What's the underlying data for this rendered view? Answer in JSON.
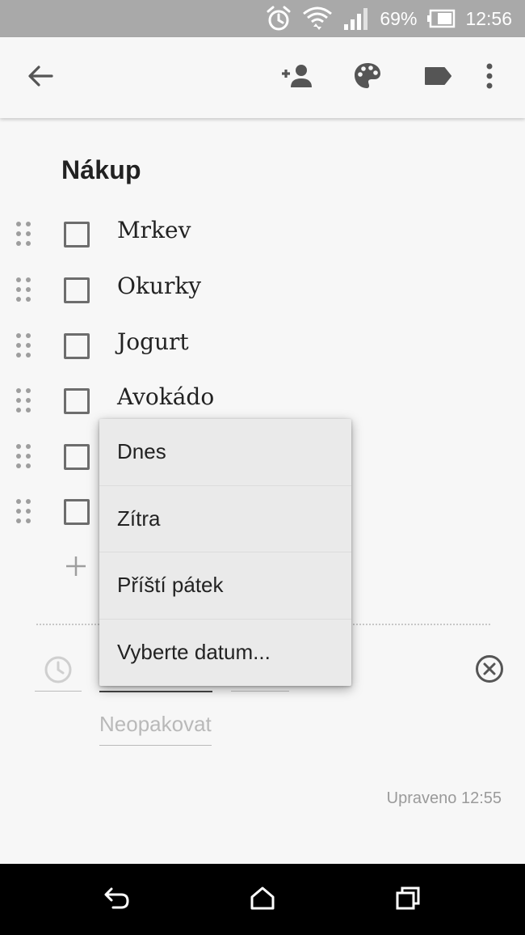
{
  "status_bar": {
    "battery_percent": "69%",
    "time": "12:56",
    "icons": [
      "alarm-icon",
      "wifi-icon",
      "signal-icon",
      "battery-icon"
    ]
  },
  "toolbar": {
    "icons": [
      "back-arrow-icon",
      "add-collaborator-icon",
      "palette-icon",
      "label-icon",
      "more-options-icon"
    ]
  },
  "note": {
    "title": "Nákup",
    "items": [
      {
        "label": "Mrkev",
        "checked": false
      },
      {
        "label": "Okurky",
        "checked": false
      },
      {
        "label": "Jogurt",
        "checked": false
      },
      {
        "label": "Avokádo",
        "checked": false
      },
      {
        "label": "",
        "checked": false
      },
      {
        "label": "",
        "checked": false
      }
    ]
  },
  "reminder": {
    "repeat_placeholder": "Neopakovat"
  },
  "date_menu": {
    "options": [
      "Dnes",
      "Zítra",
      "Příští pátek",
      "Vyberte datum..."
    ]
  },
  "footer": {
    "edited": "Upraveno 12:55"
  },
  "nav_bar": {
    "icons": [
      "nav-back-icon",
      "home-icon",
      "recents-icon"
    ]
  }
}
